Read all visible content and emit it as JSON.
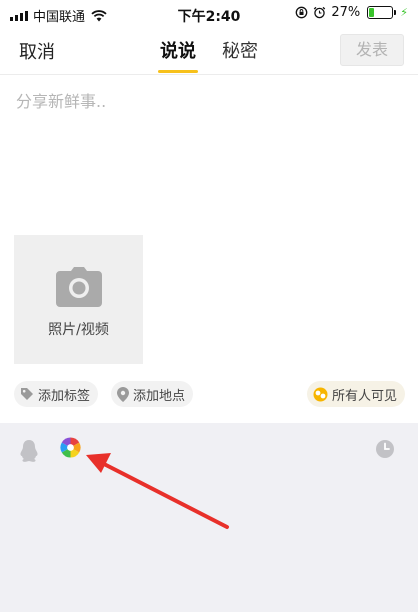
{
  "status_bar": {
    "carrier": "中国联通",
    "time": "下午2:40",
    "battery": "27%",
    "battery_level": 0.27,
    "icons": [
      "signal-icon",
      "wifi-icon",
      "orientation-lock-icon",
      "alarm-icon",
      "battery-icon",
      "charging-icon"
    ]
  },
  "nav": {
    "cancel_label": "取消",
    "tabs": [
      {
        "label": "说说",
        "active": true
      },
      {
        "label": "秘密",
        "active": false
      }
    ],
    "publish_label": "发表"
  },
  "compose": {
    "placeholder": "分享新鲜事..",
    "value": ""
  },
  "media": {
    "label": "照片/视频",
    "icon": "camera-icon"
  },
  "chips": {
    "tag": {
      "label": "添加标签",
      "icon": "tag-icon"
    },
    "location": {
      "label": "添加地点",
      "icon": "location-pin-icon"
    },
    "visibility": {
      "label": "所有人可见",
      "icon": "visibility-icon"
    }
  },
  "toolbar": {
    "icons": [
      "qq-penguin-icon",
      "pinwheel-icon",
      "clock-icon"
    ]
  },
  "colors": {
    "accent": "#f7c11b",
    "arrow": "#e8302a",
    "panel_bg": "#f0f0f4",
    "placeholder": "#b6b6b6"
  }
}
